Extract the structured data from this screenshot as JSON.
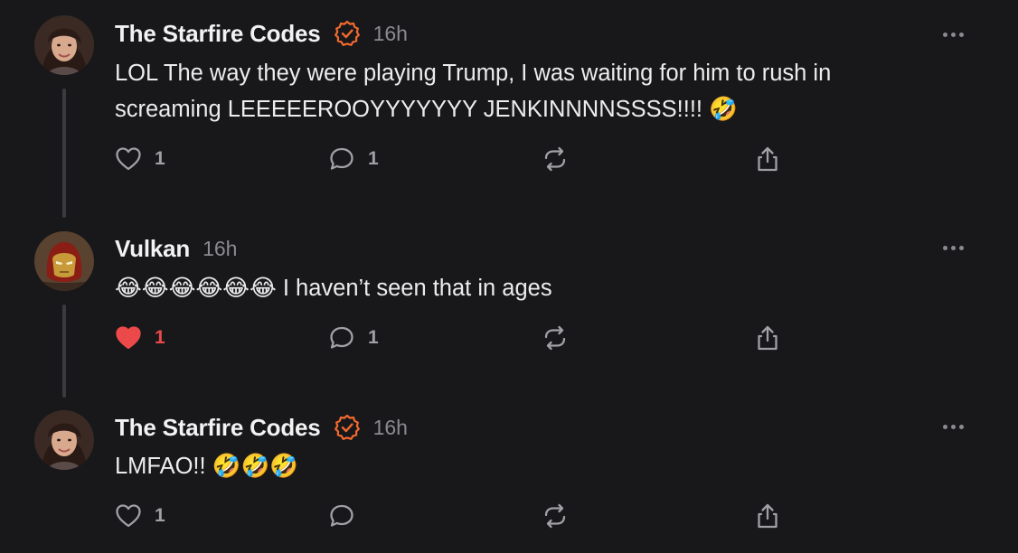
{
  "posts": [
    {
      "author": "The Starfire Codes",
      "verified": true,
      "time": "16h",
      "text": "LOL The way they were playing Trump, I was waiting for him to rush in screaming LEEEEEROOYYYYYYY JENKINNNNSSSS!!!! 🤣",
      "likes": "1",
      "liked": false,
      "replies": "1",
      "avatar": "woman-portrait-avatar"
    },
    {
      "author": "Vulkan",
      "verified": false,
      "time": "16h",
      "text": "😂😂😂😂😂😂 I haven’t seen that in ages",
      "likes": "1",
      "liked": true,
      "replies": "1",
      "avatar": "iron-man-helmet-avatar"
    },
    {
      "author": "The Starfire Codes",
      "verified": true,
      "time": "16h",
      "text": "LMFAO!! 🤣🤣🤣",
      "likes": "1",
      "liked": false,
      "replies": "",
      "avatar": "woman-portrait-avatar"
    }
  ],
  "colors": {
    "background": "#18181b",
    "verified_badge": "#f26a2e",
    "liked": "#ec4a4a",
    "muted": "#8a8a8f"
  },
  "icons": [
    "heart-icon",
    "comment-icon",
    "repost-icon",
    "share-icon",
    "more-icon",
    "verified-icon"
  ]
}
